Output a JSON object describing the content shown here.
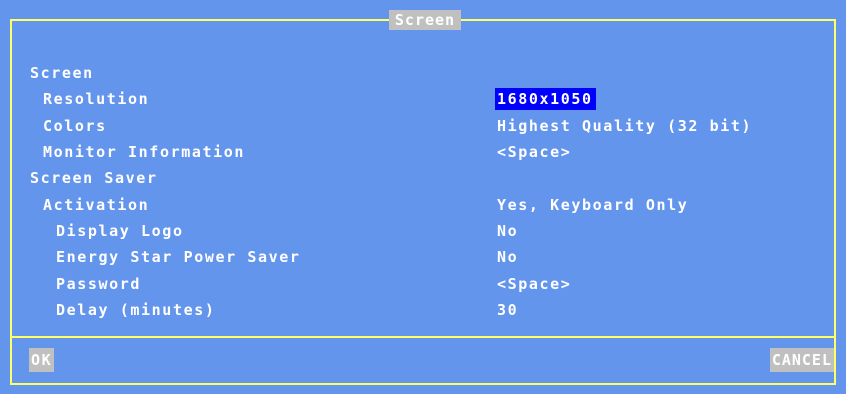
{
  "window": {
    "title": "Screen"
  },
  "sections": [
    {
      "label": "Screen",
      "rows": [
        {
          "label": "Resolution",
          "value": "1680x1050",
          "selected": true
        },
        {
          "label": "Colors",
          "value": "Highest Quality (32 bit)"
        },
        {
          "label": "Monitor Information",
          "value": "<Space>"
        }
      ]
    },
    {
      "label": "Screen Saver",
      "rows": [
        {
          "label": "Activation",
          "value": "Yes, Keyboard Only"
        },
        {
          "label": "Display Logo",
          "value": "No"
        },
        {
          "label": "Energy Star Power Saver",
          "value": "No"
        },
        {
          "label": "Password",
          "value": "<Space>"
        },
        {
          "label": "Delay (minutes)",
          "value": "30"
        }
      ]
    }
  ],
  "buttons": {
    "ok": "OK",
    "cancel": "CANCEL"
  },
  "colors": {
    "background": "#6495ed",
    "frame": "#ffff66",
    "selection": "#0000ff",
    "button_bg": "#c0c0c0",
    "text": "#ffffff"
  }
}
